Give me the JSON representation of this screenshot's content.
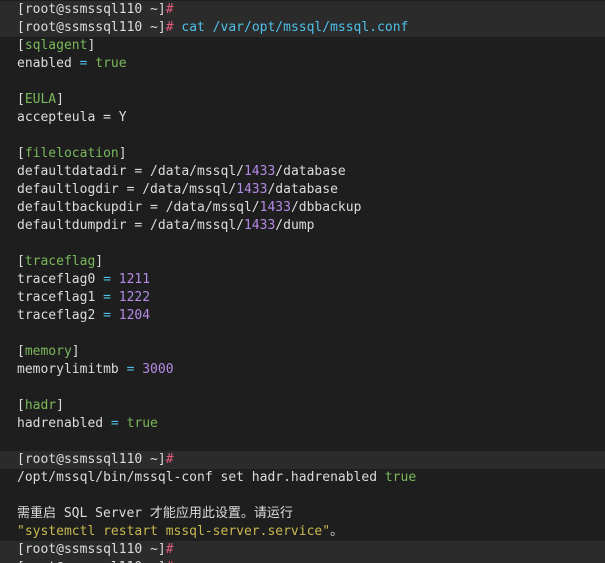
{
  "prompt": {
    "open": "[root@ssmssql110 ~]",
    "hash": "#"
  },
  "command1": "cat /var/opt/mssql/mssql.conf",
  "conf": {
    "sqlagent": {
      "header": "[sqlagent]",
      "key": "enabled",
      "eq": " = ",
      "value": "true"
    },
    "eula": {
      "header": "[EULA]",
      "key": "accepteula = Y"
    },
    "filelocation": {
      "header": "[filelocation]",
      "rows": [
        {
          "key": "defaultdatadir = /data/mssql/",
          "num": "1433",
          "rest": "/database"
        },
        {
          "key": "defaultlogdir = /data/mssql/",
          "num": "1433",
          "rest": "/database"
        },
        {
          "key": "defaultbackupdir = /data/mssql/",
          "num": "1433",
          "rest": "/dbbackup"
        },
        {
          "key": "defaultdumpdir = /data/mssql/",
          "num": "1433",
          "rest": "/dump"
        }
      ]
    },
    "traceflag": {
      "header": "[traceflag]",
      "rows": [
        {
          "key": "traceflag0",
          "eq": " = ",
          "value": "1211"
        },
        {
          "key": "traceflag1",
          "eq": " = ",
          "value": "1222"
        },
        {
          "key": "traceflag2",
          "eq": " = ",
          "value": "1204"
        }
      ]
    },
    "memory": {
      "header": "[memory]",
      "key": "memorylimitmb",
      "eq": " = ",
      "value": "3000"
    },
    "hadr": {
      "header": "[hadr]",
      "key": "hadrenabled",
      "eq": " = ",
      "value": "true"
    }
  },
  "command2": {
    "text": "/opt/mssql/bin/mssql-conf set hadr.hadrenabled ",
    "value": "true"
  },
  "message": {
    "line1": "需重启 SQL Server 才能应用此设置。请运行",
    "line2": "\"systemctl restart mssql-server.service\"",
    "line2_end": "。"
  },
  "colors": {
    "background": "#1e1e1e",
    "prompt_hash": "#e05a7a",
    "command": "#4fc1e9",
    "section": "#7ab85a",
    "number": "#b48ae6",
    "warning": "#c8b850"
  }
}
